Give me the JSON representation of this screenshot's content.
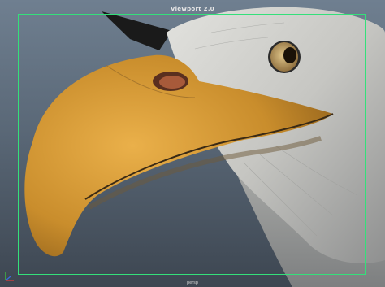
{
  "viewport": {
    "title": "Viewport 2.0",
    "camera_label": "persp"
  },
  "colors": {
    "gate": "#34e07a",
    "beak": "#d9a13a",
    "head": "#cfd0cc",
    "background_top": "#6f7f90",
    "background_bottom": "#3d4651"
  },
  "icons": {
    "axis": "xyz-axis-icon"
  }
}
